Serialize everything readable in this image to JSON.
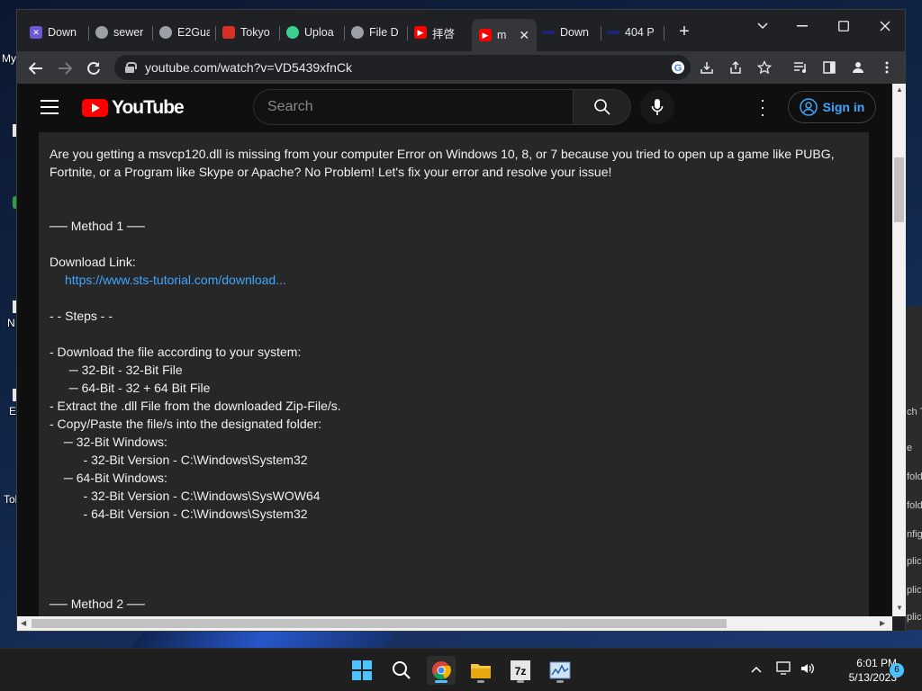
{
  "desktop": {
    "labels": [
      "My",
      "N",
      "E",
      "Tol"
    ]
  },
  "back_window": {
    "rows": [
      "ch T",
      "e",
      "fold",
      "fold",
      "nfigu",
      "plica",
      "plica",
      "plica"
    ]
  },
  "tabs": [
    {
      "title": "Down",
      "icon": "app-icon"
    },
    {
      "title": "sewer",
      "icon": "globe-icon"
    },
    {
      "title": "E2Gua",
      "icon": "globe-icon"
    },
    {
      "title": "Tokyo",
      "icon": "app-icon"
    },
    {
      "title": "Uploa",
      "icon": "cloud-icon"
    },
    {
      "title": "File D",
      "icon": "globe-icon"
    },
    {
      "title": "拝啓",
      "icon": "youtube-icon"
    },
    {
      "title": "m",
      "icon": "youtube-icon",
      "active": true
    },
    {
      "title": "Down",
      "icon": "site-icon"
    },
    {
      "title": "404 P",
      "icon": "site-icon"
    }
  ],
  "address_bar": {
    "url": "youtube.com/watch?v=VD5439xfnCk"
  },
  "youtube": {
    "logo_text": "YouTube",
    "search_placeholder": "Search",
    "signin_label": "Sign in"
  },
  "description": {
    "intro_1": "Are you getting a msvcp120.dll is missing from your computer Error on Windows 10, 8, or 7 because you tried to open up a game like PUBG,",
    "intro_2": "Fortnite, or a Program like Skype or Apache? No Problem! Let's fix your error and resolve your issue!",
    "method1": "── Method 1 ──",
    "download_label": "Download Link:",
    "download_link": "https://www.sts-tutorial.com/download...",
    "steps": "- - Steps - -",
    "s1": "- Download the file according to your system:",
    "s1a": "  ─ 32-Bit - 32-Bit File",
    "s1b": "  ─ 64-Bit - 32 + 64 Bit File",
    "s2": "- Extract the .dll File from the downloaded Zip-File/s.",
    "s3": "- Copy/Paste the file/s into the designated folder:",
    "s3a": " ─ 32-Bit Windows:",
    "s3a1": "    - 32-Bit Version - C:\\Windows\\System32",
    "s3b": " ─ 64-Bit Windows:",
    "s3b1": "    - 32-Bit Version - C:\\Windows\\SysWOW64",
    "s3b2": "    - 64-Bit Version - C:\\Windows\\System32",
    "method2": "── Method 2 ──"
  },
  "taskbar": {
    "time": "6:01 PM",
    "date": "5/13/2023",
    "notification_count": "6"
  }
}
